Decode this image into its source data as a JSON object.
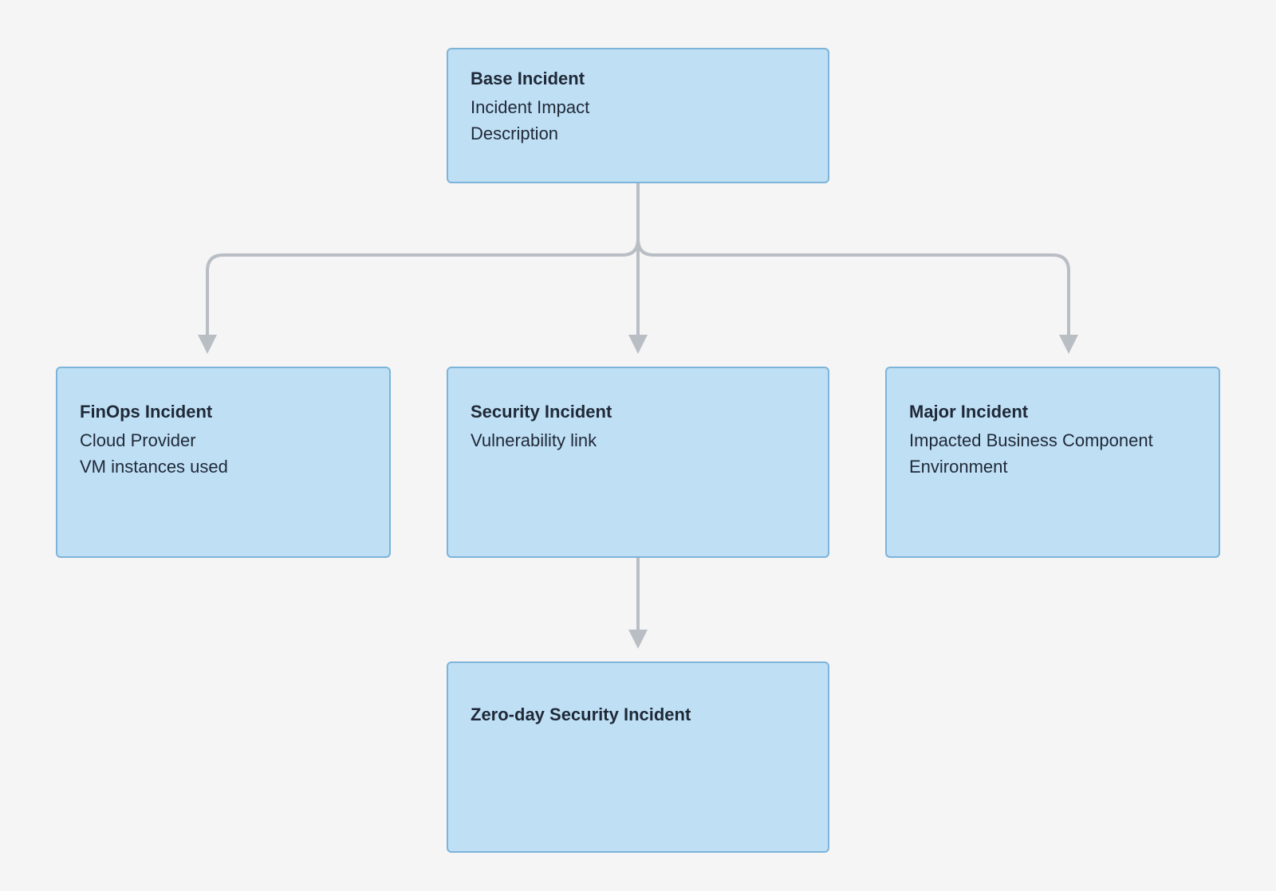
{
  "nodes": {
    "base": {
      "title": "Base Incident",
      "fields": [
        "Incident Impact",
        "Description"
      ]
    },
    "finops": {
      "title": "FinOps Incident",
      "fields": [
        "Cloud Provider",
        "VM instances used"
      ]
    },
    "security": {
      "title": "Security Incident",
      "fields": [
        "Vulnerability link"
      ]
    },
    "major": {
      "title": "Major Incident",
      "fields": [
        "Impacted Business Component",
        "Environment"
      ]
    },
    "zeroday": {
      "title": "Zero-day Security Incident",
      "fields": []
    }
  },
  "colors": {
    "nodeFill": "#bfdff5",
    "nodeBorder": "#7db4d9",
    "connector": "#b9bec4",
    "background": "#f5f5f5"
  }
}
